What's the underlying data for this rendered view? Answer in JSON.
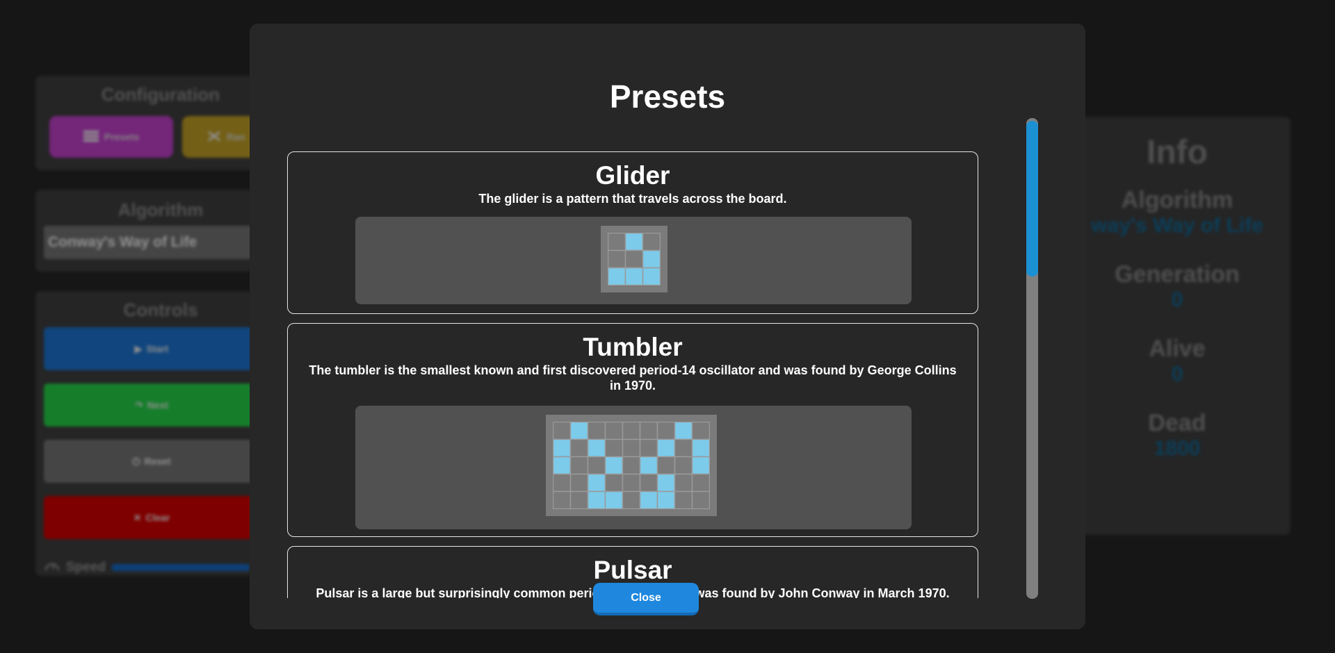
{
  "background": {
    "configuration": {
      "title": "Configuration",
      "presets_label": "Presets",
      "random_label": "Ran"
    },
    "algorithm": {
      "title": "Algorithm",
      "selected": "Conway's Way of Life"
    },
    "controls": {
      "title": "Controls",
      "start_label": "Start",
      "next_label": "Next",
      "reset_label": "Reset",
      "clear_label": "Clear",
      "speed_label": "Speed"
    },
    "info": {
      "title": "Info",
      "algorithm_label": "Algorithm",
      "algorithm_value": "way's Way of Life",
      "generation_label": "Generation",
      "generation_value": "0",
      "alive_label": "Alive",
      "alive_value": "0",
      "dead_label": "Dead",
      "dead_value": "1800"
    }
  },
  "modal": {
    "title": "Presets",
    "presets": [
      {
        "name": "Glider",
        "description": "The glider is a pattern that travels across the board.",
        "cols": 3,
        "rows": 3,
        "alive": [
          [
            0,
            1
          ],
          [
            1,
            2
          ],
          [
            2,
            0
          ],
          [
            2,
            1
          ],
          [
            2,
            2
          ]
        ]
      },
      {
        "name": "Tumbler",
        "description": "The tumbler is the smallest known and first discovered period-14 oscillator and was found by George Collins in 1970.",
        "cols": 9,
        "rows": 5,
        "alive": [
          [
            0,
            1
          ],
          [
            0,
            7
          ],
          [
            1,
            0
          ],
          [
            1,
            2
          ],
          [
            1,
            6
          ],
          [
            1,
            8
          ],
          [
            2,
            0
          ],
          [
            2,
            3
          ],
          [
            2,
            5
          ],
          [
            2,
            8
          ],
          [
            3,
            2
          ],
          [
            3,
            6
          ],
          [
            4,
            2
          ],
          [
            4,
            3
          ],
          [
            4,
            5
          ],
          [
            4,
            6
          ]
        ]
      },
      {
        "name": "Pulsar",
        "description": "Pulsar is a large but surprisingly common period-3 oscillator. It was found by John Conway in March 1970."
      }
    ],
    "close_label": "Close"
  },
  "colors": {
    "alive_cell": "#7ccbea",
    "dead_cell": "#7b7b7b",
    "accent": "#1f88de",
    "presets_button": "#b23bbb",
    "random_button": "#b19322",
    "start_button": "#1a6bc0",
    "next_button": "#22c143",
    "reset_button": "#6b6b6b",
    "clear_button": "#c40000"
  }
}
